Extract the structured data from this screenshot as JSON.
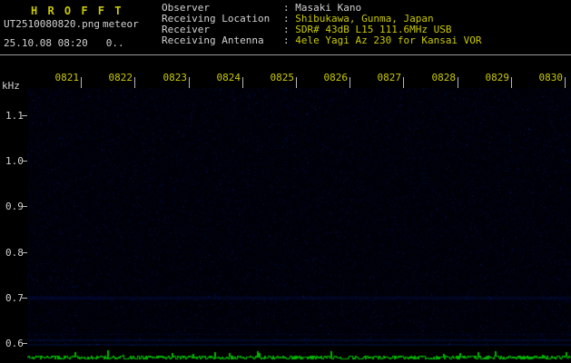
{
  "app": {
    "title": "H R O F F T",
    "filename": "UT2510080820.png",
    "station": "meteor",
    "datetime": "25.10.08 08:20",
    "counter": "0.."
  },
  "info": {
    "rows": [
      {
        "label": "Observer",
        "value": "Masaki Kano"
      },
      {
        "label": "Receiving Location",
        "value": "Shibukawa, Gunma, Japan"
      },
      {
        "label": "Receiver",
        "value": "SDR# 43dB L15 111.6MHz USB"
      },
      {
        "label": "Receiving Antenna",
        "value": "4ele Yagi Az 230 for Kansai VOR"
      }
    ]
  },
  "chart_data": {
    "type": "heatmap",
    "title": "HROFFT radio meteor echo spectrogram",
    "x_ticks": [
      "0821",
      "0822",
      "0823",
      "0824",
      "0825",
      "0826",
      "0827",
      "0828",
      "0829",
      "0830"
    ],
    "xlabel": "",
    "ylabel": "kHz",
    "y_ticks": [
      "1.1",
      "1.0",
      "0.9",
      "0.8",
      "0.7",
      "0.6"
    ],
    "ylim": [
      0.594,
      1.16
    ],
    "carrier_khz": 0.7,
    "baseline_lines_khz": [
      0.62,
      0.608,
      0.598
    ],
    "grid": false,
    "legend": "none",
    "series_note": "dark blue background noise only; faint continuous carrier line at 0.7 kHz and baseline lines near 0.6 kHz; green signal-level trace along bottom strip; no meteor echoes visible"
  },
  "colors": {
    "background": "#000000",
    "accent_yellow": "#c9c900",
    "text_white": "#d2d2d2",
    "separator_gray": "#9a9a9a",
    "noise_blue": "#0a1a3c",
    "trace_green": "#00b400"
  }
}
